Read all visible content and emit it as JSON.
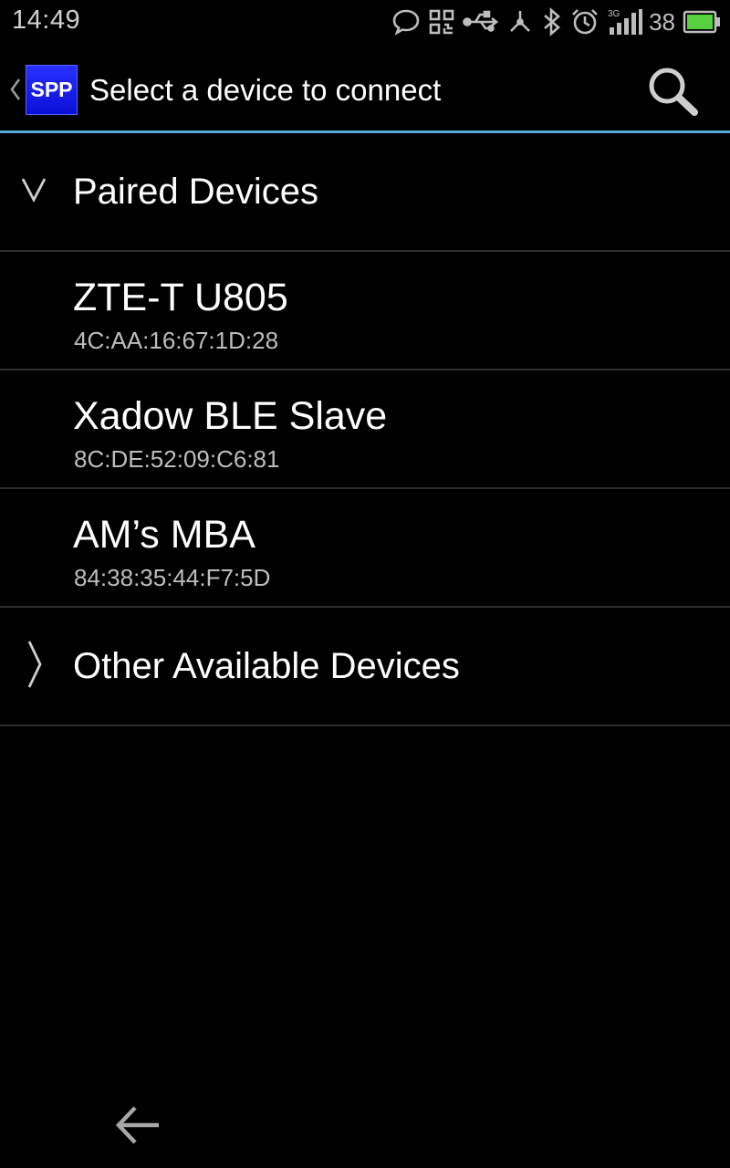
{
  "status_bar": {
    "time": "14:49",
    "battery_level": "38",
    "network_type": "3G",
    "icons": [
      "chat-icon",
      "qr-icon",
      "usb-icon",
      "usb-debug-icon",
      "bluetooth-icon",
      "alarm-icon",
      "signal-icon",
      "battery-icon"
    ]
  },
  "action_bar": {
    "app_icon_text": "SPP",
    "title": "Select a device to connect",
    "search_icon": "search-icon",
    "accent_color": "#5aa9d6"
  },
  "groups": {
    "paired": {
      "label": "Paired Devices",
      "expanded": true,
      "devices": [
        {
          "name": "ZTE-T U805",
          "address": "4C:AA:16:67:1D:28"
        },
        {
          "name": "Xadow BLE Slave",
          "address": "8C:DE:52:09:C6:81"
        },
        {
          "name": "AM’s MBA",
          "address": "84:38:35:44:F7:5D"
        }
      ]
    },
    "other": {
      "label": "Other Available Devices",
      "expanded": false
    }
  },
  "nav_bar": {
    "back_icon": "back-arrow-icon"
  }
}
